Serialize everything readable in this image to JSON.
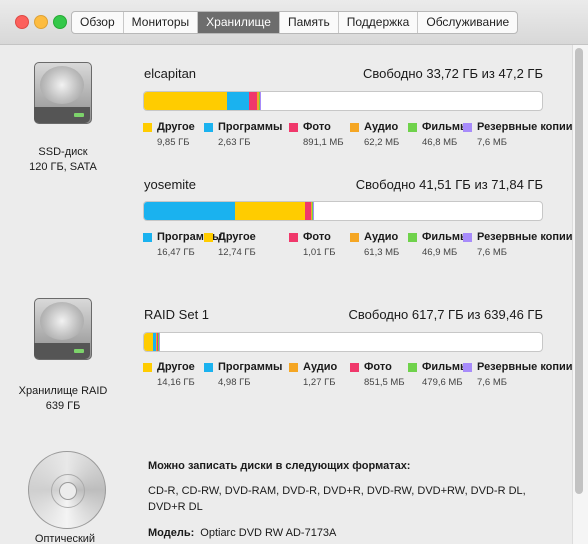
{
  "window": {
    "tabs": [
      "Обзор",
      "Мониторы",
      "Хранилище",
      "Память",
      "Поддержка",
      "Обслуживание"
    ],
    "active_tab": "Хранилище"
  },
  "disks": [
    {
      "label_line1": "SSD-диск",
      "label_line2": "120 ГБ, SATA"
    },
    {
      "label_line1": "Хранилище RAID",
      "label_line2": "639 ГБ"
    },
    {
      "label_line1": "Оптический"
    }
  ],
  "volumes": [
    {
      "name": "elcapitan",
      "free": "Свободно 33,72 ГБ из 47,2 ГБ",
      "segments": [
        {
          "color": "#ffcc00",
          "fraction": 0.209
        },
        {
          "color": "#1ab2ef",
          "fraction": 0.056
        },
        {
          "color": "#f0386b",
          "fraction": 0.019
        },
        {
          "color": "#f5a623",
          "fraction": 0.004
        },
        {
          "color": "#6fd24b",
          "fraction": 0.003
        },
        {
          "color": "#a78bfa",
          "fraction": 0.001
        }
      ],
      "legend": [
        {
          "name": "Другое",
          "value": "9,85 ГБ",
          "color": "#ffcc00"
        },
        {
          "name": "Программы",
          "value": "2,63 ГБ",
          "color": "#1ab2ef"
        },
        {
          "name": "Фото",
          "value": "891,1 МБ",
          "color": "#f0386b"
        },
        {
          "name": "Аудио",
          "value": "62,2 МБ",
          "color": "#f5a623"
        },
        {
          "name": "Фильмы",
          "value": "46,8 МБ",
          "color": "#6fd24b"
        },
        {
          "name": "Резервные копии",
          "value": "7,6 МБ",
          "color": "#a78bfa"
        }
      ]
    },
    {
      "name": "yosemite",
      "free": "Свободно 41,51 ГБ из 71,84 ГБ",
      "segments": [
        {
          "color": "#1ab2ef",
          "fraction": 0.229
        },
        {
          "color": "#ffcc00",
          "fraction": 0.177
        },
        {
          "color": "#f0386b",
          "fraction": 0.014
        },
        {
          "color": "#f5a623",
          "fraction": 0.001
        },
        {
          "color": "#6fd24b",
          "fraction": 0.001
        },
        {
          "color": "#a78bfa",
          "fraction": 0.0001
        }
      ],
      "legend": [
        {
          "name": "Программы",
          "value": "16,47 ГБ",
          "color": "#1ab2ef"
        },
        {
          "name": "Другое",
          "value": "12,74 ГБ",
          "color": "#ffcc00"
        },
        {
          "name": "Фото",
          "value": "1,01 ГБ",
          "color": "#f0386b"
        },
        {
          "name": "Аудио",
          "value": "61,3 МБ",
          "color": "#f5a623"
        },
        {
          "name": "Фильмы",
          "value": "46,9 МБ",
          "color": "#6fd24b"
        },
        {
          "name": "Резервные копии",
          "value": "7,6 МБ",
          "color": "#a78bfa"
        }
      ]
    },
    {
      "name": "RAID Set 1",
      "free": "Свободно 617,7 ГБ из 639,46 ГБ",
      "segments": [
        {
          "color": "#ffcc00",
          "fraction": 0.022
        },
        {
          "color": "#1ab2ef",
          "fraction": 0.008
        },
        {
          "color": "#f5a623",
          "fraction": 0.002
        },
        {
          "color": "#f0386b",
          "fraction": 0.001
        },
        {
          "color": "#6fd24b",
          "fraction": 0.001
        },
        {
          "color": "#a78bfa",
          "fraction": 0.0001
        }
      ],
      "legend": [
        {
          "name": "Другое",
          "value": "14,16 ГБ",
          "color": "#ffcc00"
        },
        {
          "name": "Программы",
          "value": "4,98 ГБ",
          "color": "#1ab2ef"
        },
        {
          "name": "Аудио",
          "value": "1,27 ГБ",
          "color": "#f5a623"
        },
        {
          "name": "Фото",
          "value": "851,5 МБ",
          "color": "#f0386b"
        },
        {
          "name": "Фильмы",
          "value": "479,6 МБ",
          "color": "#6fd24b"
        },
        {
          "name": "Резервные копии",
          "value": "7,6 МБ",
          "color": "#a78bfa"
        }
      ]
    }
  ],
  "optical": {
    "formats_title": "Можно записать диски в следующих форматах:",
    "formats": "CD-R, CD-RW, DVD-RAM, DVD-R, DVD+R, DVD-RW, DVD+RW, DVD-R DL, DVD+R DL",
    "model_label": "Модель:",
    "model_value": "Optiarc DVD RW AD-7173A"
  }
}
